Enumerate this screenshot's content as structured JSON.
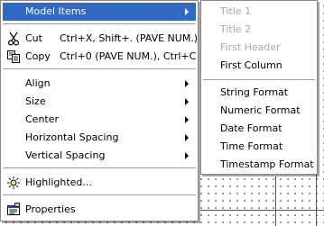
{
  "context_menu": {
    "items": [
      {
        "label": "Model Items",
        "has_submenu": true,
        "selected": true
      },
      {
        "label": "Cut",
        "shortcut": "Ctrl+X, Shift+. (PAVE NUM.)",
        "icon": "scissors-icon"
      },
      {
        "label": "Copy",
        "shortcut": "Ctrl+0 (PAVE NUM.), Ctrl+C",
        "icon": "copy-icon"
      },
      {
        "label": "Align",
        "has_submenu": true
      },
      {
        "label": "Size",
        "has_submenu": true
      },
      {
        "label": "Center",
        "has_submenu": true
      },
      {
        "label": "Horizontal Spacing",
        "has_submenu": true
      },
      {
        "label": "Vertical Spacing",
        "has_submenu": true
      },
      {
        "label": "Highlighted...",
        "icon": "sun-icon"
      },
      {
        "label": "Properties",
        "icon": "properties-icon"
      }
    ]
  },
  "submenu": {
    "items": [
      {
        "label": "Title 1",
        "enabled": false
      },
      {
        "label": "Title 2",
        "enabled": false
      },
      {
        "label": "First Header",
        "enabled": false
      },
      {
        "label": "First Column",
        "enabled": true
      },
      {
        "label": "String Format",
        "enabled": true
      },
      {
        "label": "Numeric Format",
        "enabled": true
      },
      {
        "label": "Date Format",
        "enabled": true
      },
      {
        "label": "Time Format",
        "enabled": true
      },
      {
        "label": "Timestamp Format",
        "enabled": true
      }
    ]
  },
  "colors": {
    "selection": "#316ac5",
    "disabled_text": "#a9a9a9",
    "menu_background": "#ffffff"
  }
}
